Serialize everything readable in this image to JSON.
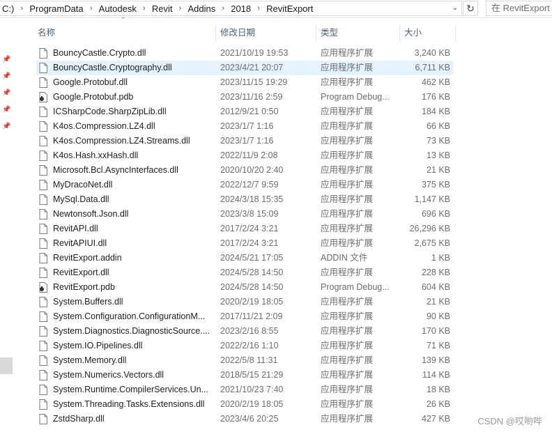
{
  "address": {
    "crumbs": [
      "C:)",
      "ProgramData",
      "Autodesk",
      "Revit",
      "Addins",
      "2018",
      "RevitExport"
    ],
    "search_placeholder": "在 RevitExport"
  },
  "icons": {
    "separator": "chevron-right-icon",
    "dropdown": "chevron-down-icon",
    "refresh": "refresh-icon",
    "pin": "pin-icon",
    "file": "file-icon",
    "pdb": "debug-file-icon"
  },
  "columns": {
    "name": "名称",
    "date": "修改日期",
    "type": "类型",
    "size": "大小"
  },
  "files": [
    {
      "name": "BouncyCastle.Crypto.dll",
      "date": "2021/10/19 19:53",
      "type": "应用程序扩展",
      "size": "3,240 KB",
      "icon": "file"
    },
    {
      "name": "BouncyCastle.Cryptography.dll",
      "date": "2023/4/21 20:07",
      "type": "应用程序扩展",
      "size": "6,711 KB",
      "icon": "file",
      "selected": true
    },
    {
      "name": "Google.Protobuf.dll",
      "date": "2023/11/15 19:29",
      "type": "应用程序扩展",
      "size": "462 KB",
      "icon": "file"
    },
    {
      "name": "Google.Protobuf.pdb",
      "date": "2023/11/16 2:59",
      "type": "Program Debug...",
      "size": "176 KB",
      "icon": "pdb"
    },
    {
      "name": "ICSharpCode.SharpZipLib.dll",
      "date": "2012/9/21 0:50",
      "type": "应用程序扩展",
      "size": "184 KB",
      "icon": "file"
    },
    {
      "name": "K4os.Compression.LZ4.dll",
      "date": "2023/1/7 1:16",
      "type": "应用程序扩展",
      "size": "66 KB",
      "icon": "file"
    },
    {
      "name": "K4os.Compression.LZ4.Streams.dll",
      "date": "2023/1/7 1:16",
      "type": "应用程序扩展",
      "size": "73 KB",
      "icon": "file"
    },
    {
      "name": "K4os.Hash.xxHash.dll",
      "date": "2022/11/9 2:08",
      "type": "应用程序扩展",
      "size": "13 KB",
      "icon": "file"
    },
    {
      "name": "Microsoft.Bcl.AsyncInterfaces.dll",
      "date": "2020/10/20 2:40",
      "type": "应用程序扩展",
      "size": "21 KB",
      "icon": "file"
    },
    {
      "name": "MyDracoNet.dll",
      "date": "2022/12/7 9:59",
      "type": "应用程序扩展",
      "size": "375 KB",
      "icon": "file"
    },
    {
      "name": "MySql.Data.dll",
      "date": "2024/3/18 15:35",
      "type": "应用程序扩展",
      "size": "1,147 KB",
      "icon": "file"
    },
    {
      "name": "Newtonsoft.Json.dll",
      "date": "2023/3/8 15:09",
      "type": "应用程序扩展",
      "size": "696 KB",
      "icon": "file"
    },
    {
      "name": "RevitAPI.dll",
      "date": "2017/2/24 3:21",
      "type": "应用程序扩展",
      "size": "26,296 KB",
      "icon": "file"
    },
    {
      "name": "RevitAPIUI.dll",
      "date": "2017/2/24 3:21",
      "type": "应用程序扩展",
      "size": "2,675 KB",
      "icon": "file"
    },
    {
      "name": "RevitExport.addin",
      "date": "2024/5/21 17:05",
      "type": "ADDIN 文件",
      "size": "1 KB",
      "icon": "file"
    },
    {
      "name": "RevitExport.dll",
      "date": "2024/5/28 14:50",
      "type": "应用程序扩展",
      "size": "228 KB",
      "icon": "file"
    },
    {
      "name": "RevitExport.pdb",
      "date": "2024/5/28 14:50",
      "type": "Program Debug...",
      "size": "604 KB",
      "icon": "pdb"
    },
    {
      "name": "System.Buffers.dll",
      "date": "2020/2/19 18:05",
      "type": "应用程序扩展",
      "size": "21 KB",
      "icon": "file"
    },
    {
      "name": "System.Configuration.ConfigurationM...",
      "date": "2017/11/21 2:09",
      "type": "应用程序扩展",
      "size": "90 KB",
      "icon": "file"
    },
    {
      "name": "System.Diagnostics.DiagnosticSource....",
      "date": "2023/2/16 8:55",
      "type": "应用程序扩展",
      "size": "170 KB",
      "icon": "file"
    },
    {
      "name": "System.IO.Pipelines.dll",
      "date": "2022/2/16 1:10",
      "type": "应用程序扩展",
      "size": "71 KB",
      "icon": "file"
    },
    {
      "name": "System.Memory.dll",
      "date": "2022/5/8 11:31",
      "type": "应用程序扩展",
      "size": "139 KB",
      "icon": "file"
    },
    {
      "name": "System.Numerics.Vectors.dll",
      "date": "2018/5/15 21:29",
      "type": "应用程序扩展",
      "size": "114 KB",
      "icon": "file"
    },
    {
      "name": "System.Runtime.CompilerServices.Un...",
      "date": "2021/10/23 7:40",
      "type": "应用程序扩展",
      "size": "18 KB",
      "icon": "file"
    },
    {
      "name": "System.Threading.Tasks.Extensions.dll",
      "date": "2020/2/19 18:05",
      "type": "应用程序扩展",
      "size": "26 KB",
      "icon": "file"
    },
    {
      "name": "ZstdSharp.dll",
      "date": "2023/4/6 20:25",
      "type": "应用程序扩展",
      "size": "427 KB",
      "icon": "file"
    }
  ],
  "watermark": "CSDN @哎喲哔"
}
